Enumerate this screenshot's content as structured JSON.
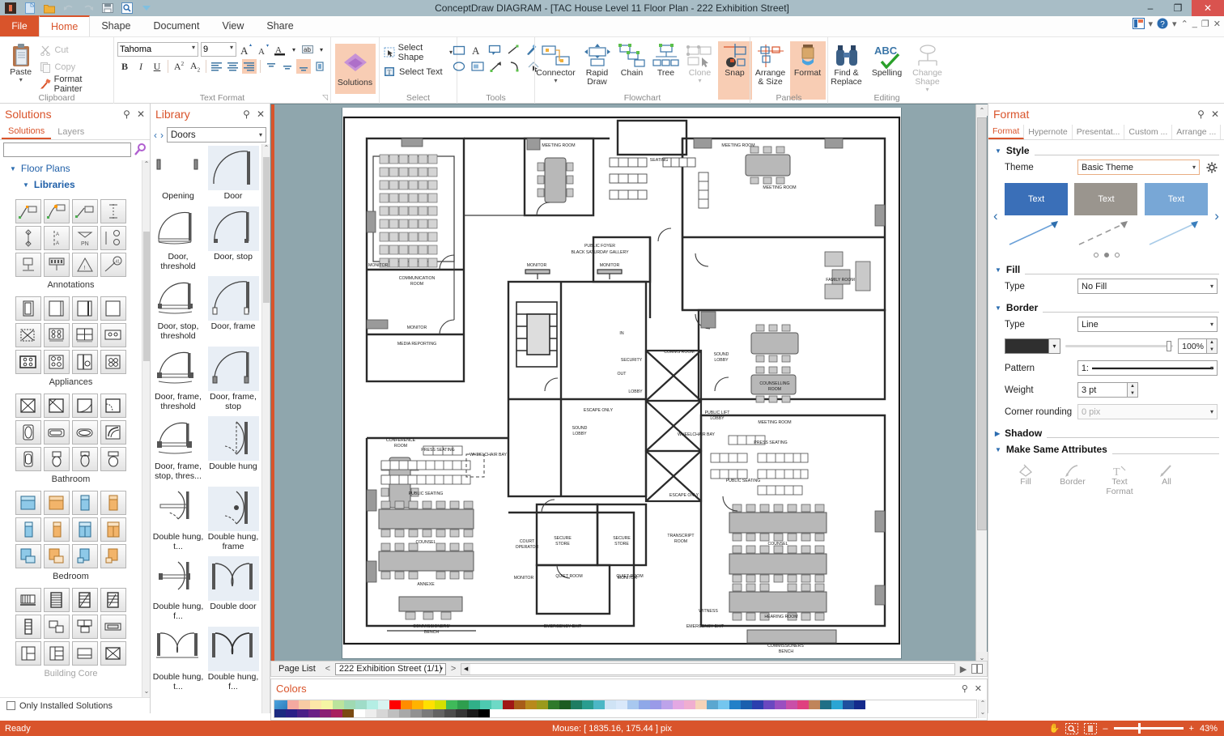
{
  "window": {
    "title": "ConceptDraw DIAGRAM - [TAC House Level 11 Floor Plan - 222 Exhibition Street]",
    "minimize": "–",
    "restore": "❐",
    "close": "✕"
  },
  "quick_access": {
    "items": [
      {
        "name": "app-logo-icon",
        "glyph": "▣"
      },
      {
        "name": "new-document-icon",
        "glyph": "🗋"
      },
      {
        "name": "open-folder-icon",
        "glyph": "🗀"
      },
      {
        "name": "undo-icon",
        "glyph": "↶"
      },
      {
        "name": "redo-icon",
        "glyph": "↷"
      },
      {
        "name": "save-icon",
        "glyph": "💾"
      },
      {
        "name": "preview-icon",
        "glyph": "🔍"
      },
      {
        "name": "customize-qat-icon",
        "glyph": "▾"
      }
    ]
  },
  "ribbon": {
    "file_tab": "File",
    "tabs": [
      "Home",
      "Shape",
      "Document",
      "View",
      "Share"
    ],
    "active_tab": "Home",
    "right_controls": [
      {
        "name": "account-icon",
        "glyph": "▤"
      },
      {
        "name": "account-dropdown-icon",
        "glyph": "▾"
      },
      {
        "name": "help-icon",
        "glyph": "?"
      },
      {
        "name": "help-dropdown-icon",
        "glyph": "▾"
      },
      {
        "name": "ribbon-collapse-icon",
        "glyph": "⌃"
      },
      {
        "name": "doc-minimize-icon",
        "glyph": "_"
      },
      {
        "name": "doc-restore-icon",
        "glyph": "❐"
      },
      {
        "name": "doc-close-icon",
        "glyph": "✕"
      }
    ],
    "groups": [
      {
        "name": "Clipboard",
        "label": "Clipboard",
        "paste": "Paste",
        "cut": "Cut",
        "copy": "Copy",
        "format_painter": "Format Painter"
      },
      {
        "name": "Text Format",
        "label": "Text Format",
        "font_family": "Tahoma",
        "font_size": "9",
        "buttons": [
          "A↑",
          "A↓",
          "A",
          "▾",
          "ab",
          "▾",
          "B",
          "I",
          "U",
          "A²",
          "A₂"
        ]
      },
      {
        "name": "Solutions",
        "label": "",
        "solutions": "Solutions"
      },
      {
        "name": "Select",
        "label": "Select",
        "select_shape": "Select Shape",
        "select_text": "Select Text"
      },
      {
        "name": "Tools",
        "label": "Tools"
      },
      {
        "name": "Flowchart",
        "label": "Flowchart",
        "items": [
          "Connector",
          "Rapid Draw",
          "Chain",
          "Tree",
          "Clone",
          "Snap"
        ]
      },
      {
        "name": "Panels",
        "label": "Panels",
        "items": [
          "Arrange & Size",
          "Format"
        ]
      },
      {
        "name": "Editing",
        "label": "Editing",
        "items": [
          "Find & Replace",
          "Spelling",
          "Change Shape"
        ]
      }
    ]
  },
  "solutions_panel": {
    "title": "Solutions",
    "pin_icon": "⚲",
    "close_icon": "✕",
    "tabs": [
      "Solutions",
      "Layers"
    ],
    "active_tab": "Solutions",
    "search_value": "",
    "search_placeholder": "",
    "tree": [
      {
        "label": "Floor Plans",
        "level": 1,
        "expanded": true
      },
      {
        "label": "Libraries",
        "level": 2,
        "expanded": true
      }
    ],
    "libraries": [
      {
        "caption": "Annotations"
      },
      {
        "caption": "Appliances"
      },
      {
        "caption": "Bathroom"
      },
      {
        "caption": "Bedroom"
      },
      {
        "caption": "Building Core"
      }
    ],
    "only_installed_label": "Only Installed Solutions",
    "only_installed_checked": false
  },
  "library_panel": {
    "title": "Library",
    "pin_icon": "⚲",
    "close_icon": "✕",
    "prev_icon": "‹",
    "next_icon": "›",
    "selected_library": "Doors",
    "items": [
      {
        "caption": "Opening",
        "selected": false
      },
      {
        "caption": "Door",
        "selected": true
      },
      {
        "caption": "Door, threshold",
        "selected": false
      },
      {
        "caption": "Door, stop",
        "selected": true
      },
      {
        "caption": "Door, stop, threshold",
        "selected": false
      },
      {
        "caption": "Door, frame",
        "selected": true
      },
      {
        "caption": "Door, frame, threshold",
        "selected": false
      },
      {
        "caption": "Door, frame, stop",
        "selected": true
      },
      {
        "caption": "Door, frame, stop, thres...",
        "selected": false
      },
      {
        "caption": "Double hung",
        "selected": true
      },
      {
        "caption": "Double hung, t...",
        "selected": false
      },
      {
        "caption": "Double hung, frame",
        "selected": true
      },
      {
        "caption": "Double hung, f...",
        "selected": false
      },
      {
        "caption": "Double door",
        "selected": true
      },
      {
        "caption": "Double hung, t...",
        "selected": false
      },
      {
        "caption": "Double hung, f...",
        "selected": true
      }
    ]
  },
  "canvas": {
    "document_name": "222 Exhibition Street",
    "floorplan_labels": [
      "MEETING ROOM",
      "MEETING ROOM",
      "MEETING ROOM",
      "SEATING",
      "PUBLIC FOYER",
      "BLACK SATURDAY GALLERY",
      "FAMILY ROOM",
      "MONITOR",
      "MONITOR",
      "MONITOR",
      "MONITOR",
      "MONITOR",
      "MONITOR",
      "COMMUNICATION ROOM",
      "MEDIA REPORTING",
      "CONFERENCE ROOM",
      "COUNSELLING ROOM",
      "MEETING ROOM",
      "PRESS SEATING",
      "COMMS ROOM",
      "SOUND LOBBY",
      "SOUND LOBBY",
      "IN",
      "OUT",
      "SECURITY",
      "LOBBY",
      "ESCAPE ONLY",
      "ESCAPE ONLY",
      "ESCAPE ONLY",
      "PUBLIC LIFT LOBBY",
      "WHEELCHAIR BAY",
      "WHEELCHAIR BAY",
      "PRESS SEATING",
      "PUBLIC SEATING",
      "PUBLIC SEATING",
      "PUBLIC SEATING",
      "COUNSEL",
      "COUNSEL",
      "ANNEXE",
      "COURT OPERATOR",
      "SECURE STORE",
      "SECURE STORE",
      "SECURE STORE",
      "TRANSCRIPT ROOM",
      "QUIET ROOM",
      "QUIET ROOM",
      "WITNESS",
      "HEARING ROOM",
      "COMMISSIONERS' BENCH",
      "COMMISSIONERS' BENCH",
      "EMERGENCY EXIT",
      "EMERGENCY EXIT"
    ]
  },
  "page_bar": {
    "label": "Page List",
    "prev_icon": "<",
    "next_icon": ">",
    "page_value": "222 Exhibition Street (1/1)",
    "dropdown_icon": "▾"
  },
  "colors_panel": {
    "title": "Colors",
    "pin_icon": "⚲",
    "close_icon": "✕",
    "palette_row1": [
      "#f4a9a0",
      "#f8cba4",
      "#fde7a8",
      "#f5f5a4",
      "#bbe39c",
      "#9fd9b2",
      "#9fdcc8",
      "#b4eee4",
      "#d8f3f1",
      "#ff0000",
      "#ff8c00",
      "#ffb300",
      "#ffe000",
      "#d4e000",
      "#3fba5a",
      "#2e9e4e",
      "#31b088",
      "#4dc9b0",
      "#6dd9c6",
      "#a01616",
      "#a85c18",
      "#b8891c",
      "#9a9a1c",
      "#2f7a2a",
      "#1d5c22",
      "#1e7d62",
      "#2a9d90",
      "#4cb7c6",
      "#cfe3f5",
      "#d9e8fa",
      "#a8c8ef",
      "#8fa8e8",
      "#9a9ae8",
      "#bda3ea",
      "#e3a8e3",
      "#f0aed0",
      "#f5d3b8",
      "#5ba7d0",
      "#74c6ef",
      "#2380c8",
      "#1a5fae",
      "#2b3fae",
      "#6a48c0",
      "#9a4fc0",
      "#c94fa8",
      "#e0407f",
      "#c0845a",
      "#1e6f86",
      "#2aa5d4",
      "#1f4f9e",
      "#142a8c"
    ],
    "palette_row2": [
      "#1b2a80",
      "#2a1f86",
      "#4a1f86",
      "#6a1f86",
      "#8a1f74",
      "#a81f5e",
      "#7a4a12",
      "#ffffff",
      "#ededed",
      "#d6d6d6",
      "#bfbfbf",
      "#a8a8a8",
      "#919191",
      "#7a7a7a",
      "#636363",
      "#4c4c4c",
      "#353535",
      "#1a1a1a",
      "#000000"
    ]
  },
  "format_panel": {
    "title": "Format",
    "pin_icon": "⚲",
    "close_icon": "✕",
    "tabs": [
      "Format",
      "Hypernote",
      "Presentat...",
      "Custom ...",
      "Arrange ..."
    ],
    "active_tab": "Format",
    "sections": {
      "style": {
        "title": "Style",
        "theme_label": "Theme",
        "theme_value": "Basic Theme",
        "gear_icon": "⚙",
        "prev_icon": "‹",
        "next_icon": "›",
        "previews": [
          {
            "text": "Text",
            "color": "#3a6fb8"
          },
          {
            "text": "Text",
            "color": "#9a958e"
          },
          {
            "text": "Text",
            "color": "#78a7d6"
          }
        ],
        "dots": [
          false,
          true,
          false
        ]
      },
      "fill": {
        "title": "Fill",
        "type_label": "Type",
        "type_value": "No Fill"
      },
      "border": {
        "title": "Border",
        "type_label": "Type",
        "type_value": "Line",
        "color_hex": "#2f2f2f",
        "opacity_value": "100%",
        "pattern_label": "Pattern",
        "pattern_value": "1:",
        "weight_label": "Weight",
        "weight_value": "3 pt",
        "corner_label": "Corner rounding",
        "corner_value": "0 pix"
      },
      "shadow": {
        "title": "Shadow",
        "expanded": false
      },
      "make_same": {
        "title": "Make Same Attributes",
        "items": [
          "Fill",
          "Border",
          "Text Format",
          "All"
        ]
      }
    }
  },
  "status_bar": {
    "ready": "Ready",
    "mouse": "Mouse: [ 1835.16, 175.44 ] pix",
    "pan_icon": "✋",
    "zoom_tool_icon": "⌕",
    "fit_icon": "⛶",
    "zoom_out": "–",
    "zoom_in": "+",
    "zoom_level": "43%"
  },
  "theme": {
    "accent": "#d9542b",
    "titlebar": "#a8bdc6",
    "ribbon_selected": "#f8cdb4",
    "canvas_bg": "#8fa6ad"
  }
}
